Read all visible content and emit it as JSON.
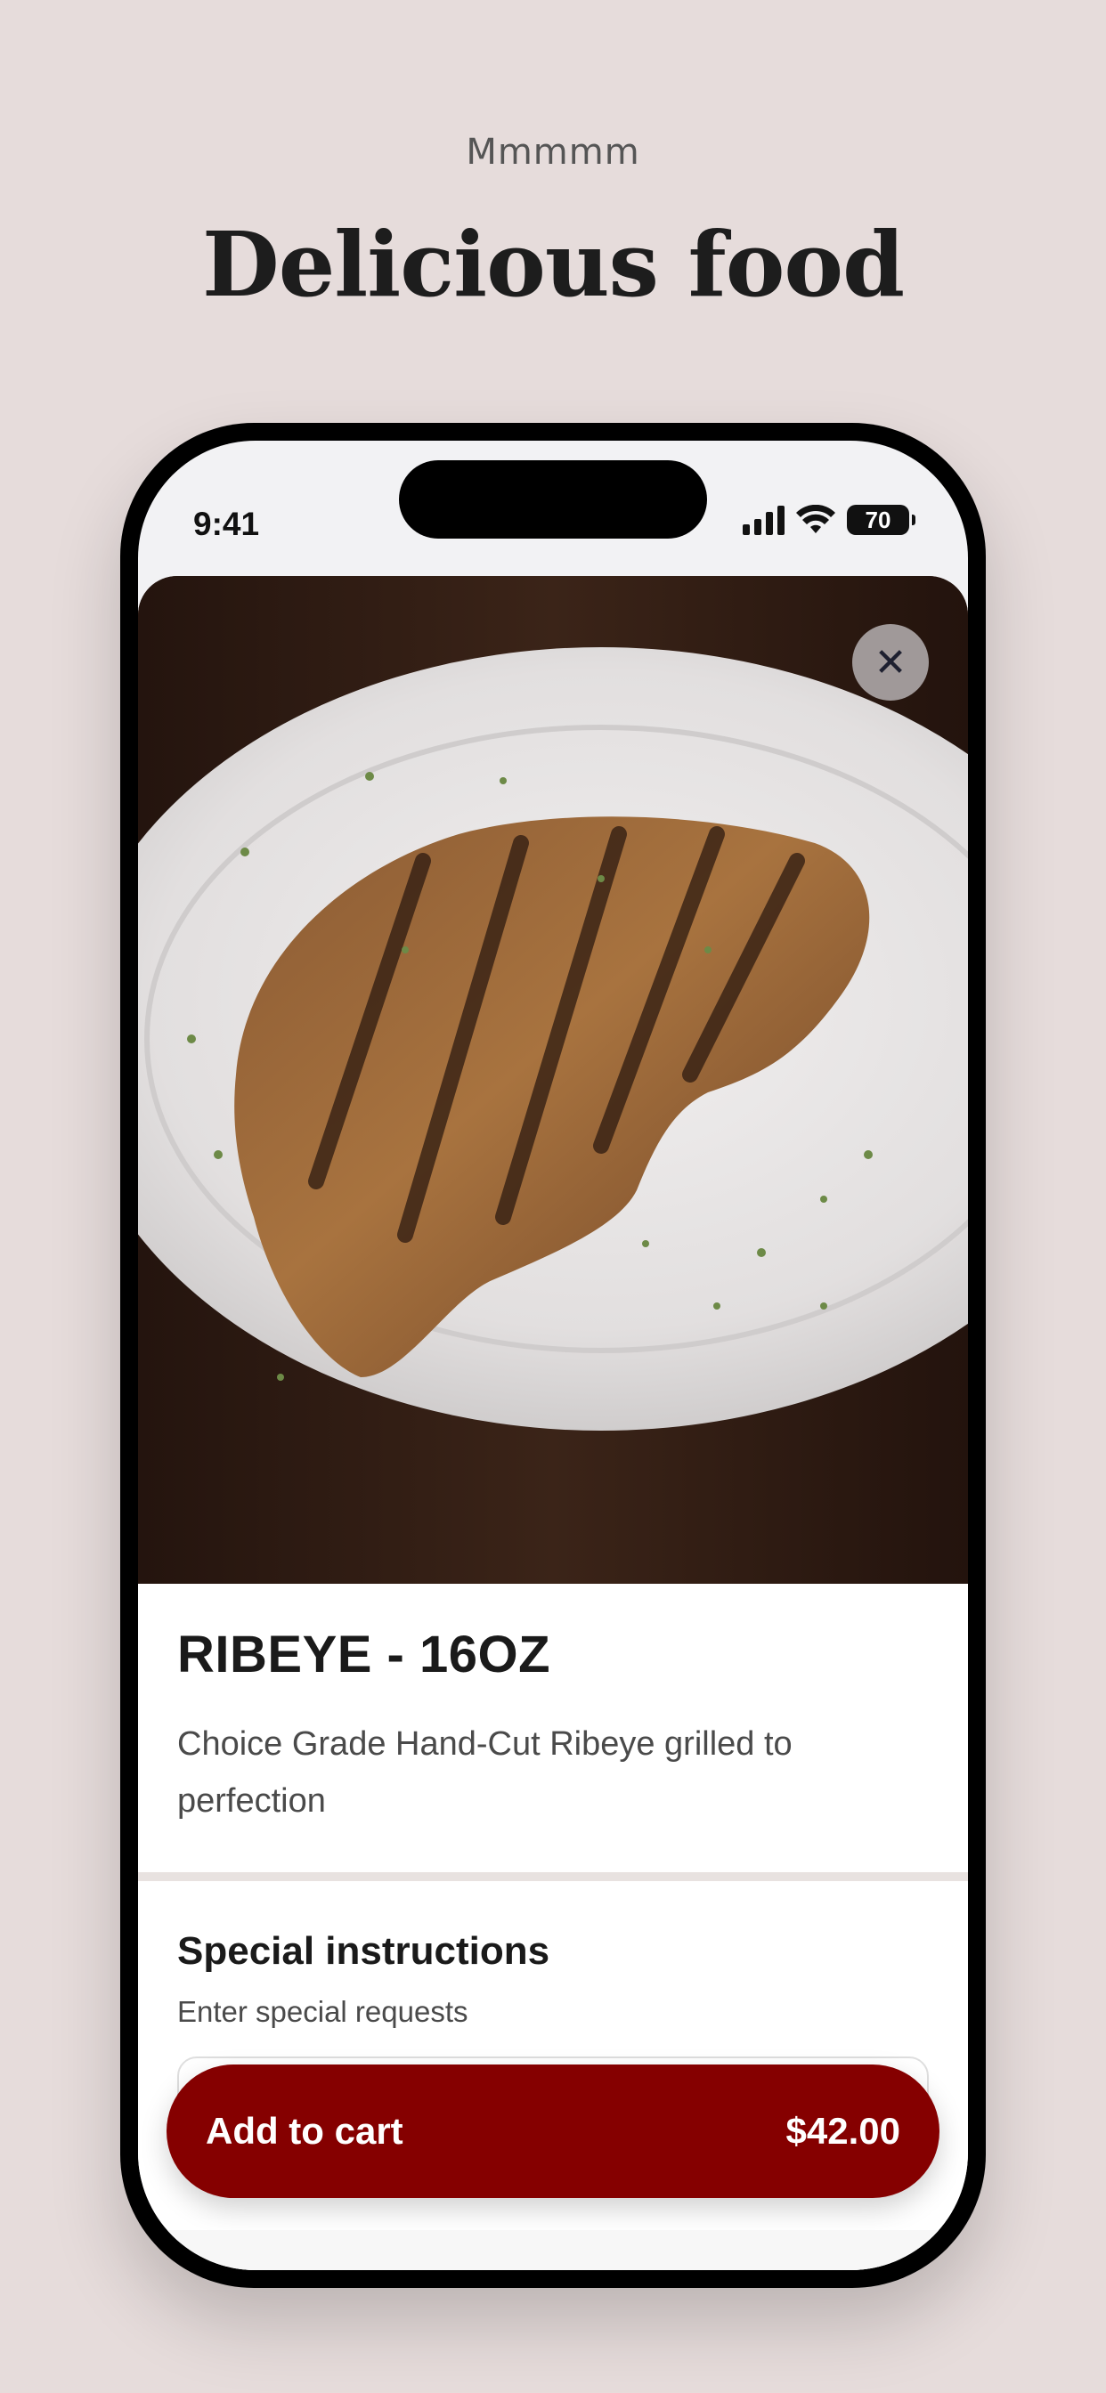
{
  "header": {
    "kicker": "Mmmmm",
    "headline": "Delicious food"
  },
  "status_bar": {
    "time": "9:41",
    "battery": "70"
  },
  "item": {
    "name": "RIBEYE - 16OZ",
    "description": "Choice Grade Hand-Cut Ribeye grilled to perfection",
    "image": "grilled ribeye steak on white plate"
  },
  "special_instructions": {
    "title": "Special instructions",
    "subtitle": "Enter special requests",
    "value": ""
  },
  "cart": {
    "label": "Add to cart",
    "price": "$42.00"
  },
  "colors": {
    "background": "#e6dcdb",
    "accent": "#850000"
  },
  "icons": {
    "close": "close-icon"
  }
}
